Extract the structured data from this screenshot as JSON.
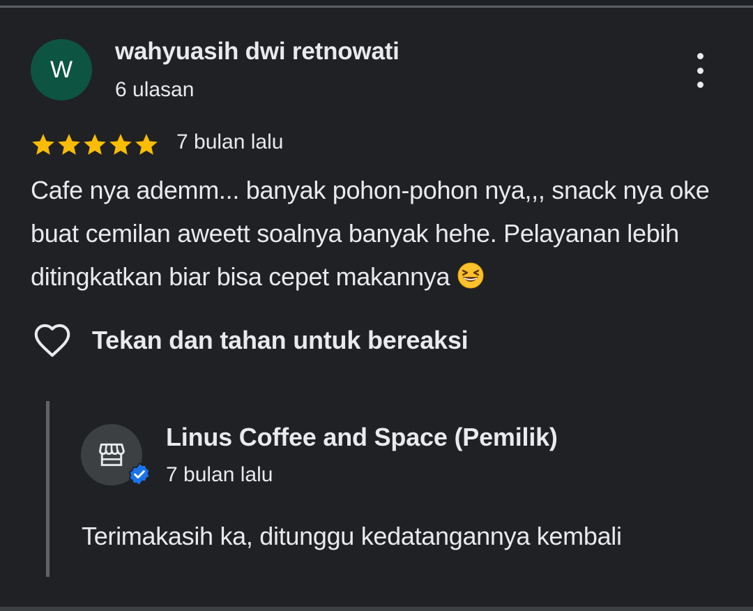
{
  "colors": {
    "background": "#202124",
    "avatar": "#0d5443",
    "star": "#fbbc04",
    "verified": "#1a73e8",
    "text": "#e8eaed"
  },
  "review": {
    "avatar_initial": "W",
    "reviewer_name": "wahyuasih dwi retnowati",
    "review_count": "6 ulasan",
    "rating": 5,
    "max_rating": 5,
    "time": "7 bulan lalu",
    "text": "Cafe nya ademm... banyak pohon-pohon nya,,, snack nya oke buat cemilan aweett soalnya banyak hehe. Pelayanan lebih ditingkatkan biar bisa cepet makannya",
    "emoji": "grinning-squinting-face-emoji",
    "more_icon": "more-vert-icon"
  },
  "reaction": {
    "icon": "heart-outline-icon",
    "label": "Tekan dan tahan untuk bereaksi"
  },
  "owner_reply": {
    "avatar_icon": "storefront-icon",
    "badge_icon": "verified-badge-icon",
    "name": "Linus Coffee and Space (Pemilik)",
    "time": "7 bulan lalu",
    "text": "Terimakasih ka, ditunggu kedatangannya kembali"
  }
}
